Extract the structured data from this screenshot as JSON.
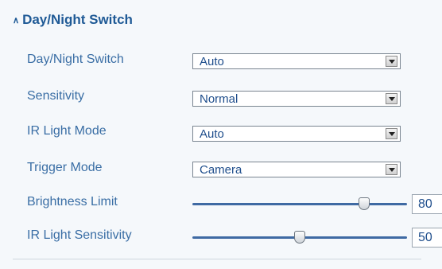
{
  "section": {
    "title": "Day/Night Switch",
    "expanded": true
  },
  "fields": {
    "day_night_switch": {
      "label": "Day/Night Switch",
      "value": "Auto"
    },
    "sensitivity": {
      "label": "Sensitivity",
      "value": "Normal"
    },
    "ir_light_mode": {
      "label": "IR Light Mode",
      "value": "Auto"
    },
    "trigger_mode": {
      "label": "Trigger Mode",
      "value": "Camera"
    },
    "brightness_limit": {
      "label": "Brightness Limit",
      "value": "80",
      "min": 0,
      "max": 100
    },
    "ir_light_sensitivity": {
      "label": "IR Light Sensitivity",
      "value": "50",
      "min": 0,
      "max": 100
    }
  },
  "colors": {
    "accent": "#1f5a96",
    "label": "#3a6ea5",
    "background": "#f5f8fb",
    "track": "#3f6aa3"
  }
}
